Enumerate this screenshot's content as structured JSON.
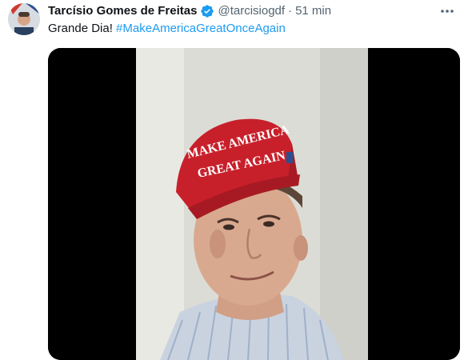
{
  "tweet": {
    "author": {
      "name": "Tarcísio Gomes de Freitas",
      "handle": "@tarcisiogdf",
      "avatar_icon": "profile-avatar"
    },
    "separator": "·",
    "time": "51 min",
    "text": "Grande Dia!",
    "hashtag": "#MakeAmericaGreatOnceAgain",
    "media": {
      "kind": "video",
      "hat_text_line1": "MAKE AMERICA",
      "hat_text_line2": "GREAT AGAIN"
    }
  },
  "colors": {
    "text_primary": "#0f1419",
    "text_secondary": "#536471",
    "link": "#1d9bf0",
    "verified_badge": "#1d9bf0",
    "hat_red": "#c8202b"
  },
  "icons": {
    "verified": "verified-badge-icon",
    "more": "more-dots-icon"
  }
}
